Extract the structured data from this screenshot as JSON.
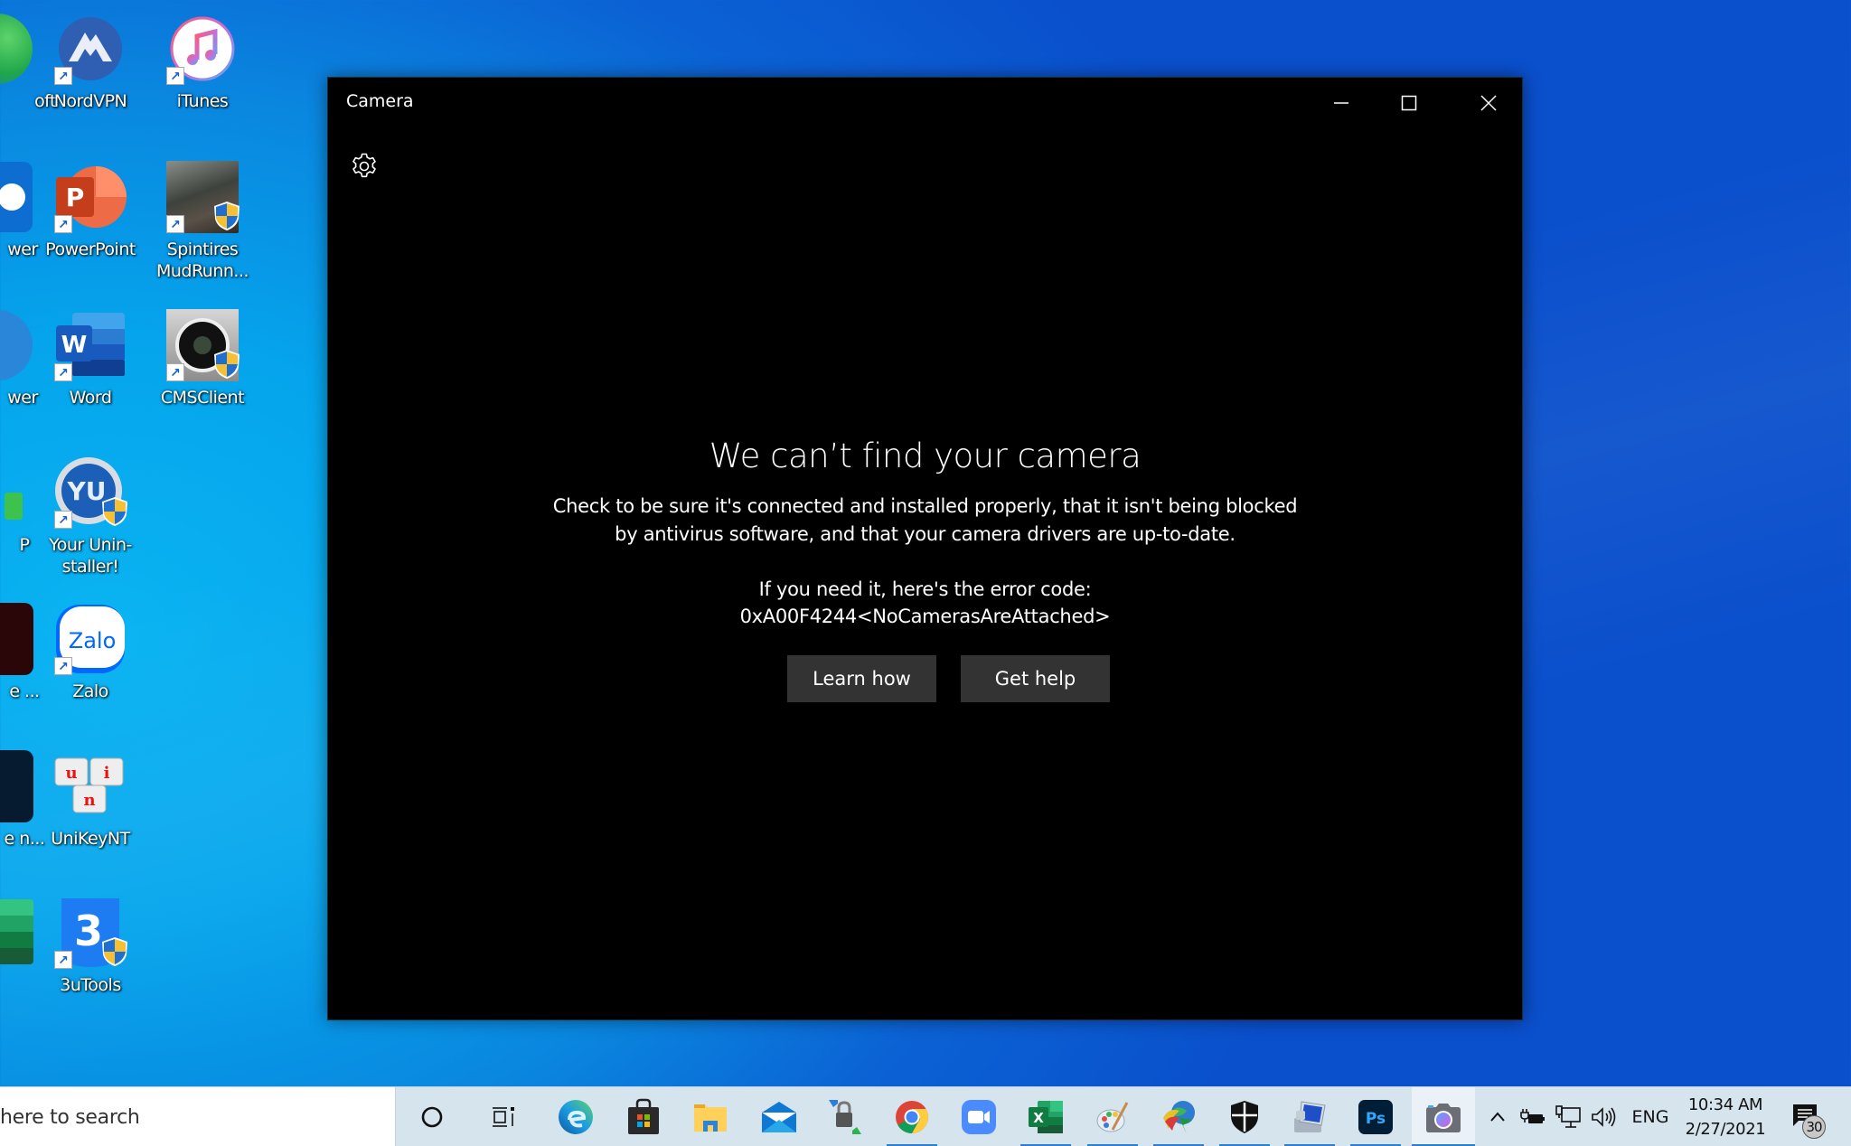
{
  "desktop": {
    "icons": [
      {
        "label": "oft",
        "icon": "edge-green-icon"
      },
      {
        "label": "NordVPN",
        "icon": "nordvpn-icon"
      },
      {
        "label": "iTunes",
        "icon": "itunes-icon"
      },
      {
        "label": "wer",
        "icon": "teamviewer-icon"
      },
      {
        "label": "PowerPoint",
        "icon": "powerpoint-icon"
      },
      {
        "label": "Spintires MudRunn...",
        "icon": "spintires-icon"
      },
      {
        "label": "wer",
        "icon": "blue-circle-icon"
      },
      {
        "label": "Word",
        "icon": "word-icon"
      },
      {
        "label": "CMSClient",
        "icon": "cmsclient-icon"
      },
      {
        "label": "P",
        "icon": "green-app-icon"
      },
      {
        "label": "Your Unin-staller!",
        "icon": "uninstaller-icon"
      },
      {
        "label": "e ...",
        "icon": "dark-red-app-icon"
      },
      {
        "label": "Zalo",
        "icon": "zalo-icon"
      },
      {
        "label": "e n...",
        "icon": "dark-blue-app-icon"
      },
      {
        "label": "UniKeyNT",
        "icon": "unikey-icon"
      },
      {
        "label": "",
        "icon": "excel-partial-icon"
      },
      {
        "label": "3uTools",
        "icon": "3utools-icon"
      }
    ]
  },
  "camera_window": {
    "title": "Camera",
    "controls": {
      "minimize": "minimize",
      "maximize": "maximize",
      "close": "close"
    },
    "settings_icon": "gear-icon",
    "error": {
      "title": "We can’t find your camera",
      "description_line1": "Check to be sure it's connected and installed properly, that it isn't being blocked",
      "description_line2": "by antivirus software, and that your camera drivers are up-to-date.",
      "code_intro": "If you need it, here's the error code:",
      "code": "0xA00F4244<NoCamerasAreAttached>"
    },
    "buttons": {
      "learn_how": "Learn how",
      "get_help": "Get help"
    }
  },
  "taskbar": {
    "search_placeholder": "here to search",
    "apps": [
      {
        "name": "cortana",
        "icon": "cortana-circle-icon",
        "running": false
      },
      {
        "name": "task-view",
        "icon": "task-view-icon",
        "running": false
      },
      {
        "name": "edge",
        "icon": "edge-icon",
        "running": false
      },
      {
        "name": "microsoft-store",
        "icon": "store-bag-icon",
        "running": false
      },
      {
        "name": "file-explorer",
        "icon": "folder-icon",
        "running": false
      },
      {
        "name": "mail",
        "icon": "mail-envelope-icon",
        "running": false
      },
      {
        "name": "vpn-lock-tool",
        "icon": "padlock-arrows-icon",
        "running": false
      },
      {
        "name": "chrome",
        "icon": "chrome-icon",
        "running": true
      },
      {
        "name": "zoom",
        "icon": "zoom-camera-icon",
        "running": false
      },
      {
        "name": "excel",
        "icon": "excel-icon",
        "running": true
      },
      {
        "name": "paint",
        "icon": "paint-palette-icon",
        "running": true
      },
      {
        "name": "internet-download-manager",
        "icon": "idm-globe-icon",
        "running": true
      },
      {
        "name": "windows-security",
        "icon": "shield-icon",
        "running": true
      },
      {
        "name": "network-tool",
        "icon": "computer-network-icon",
        "running": true
      },
      {
        "name": "photoshop",
        "icon": "photoshop-icon",
        "running": true
      },
      {
        "name": "camera",
        "icon": "camera-icon",
        "running": true,
        "active": true
      }
    ],
    "tray": {
      "show_hidden": "^",
      "language": "ENG",
      "time": "10:34 AM",
      "date": "2/27/2021",
      "notification_count": "30"
    }
  },
  "colors": {
    "taskbar_bg": "#d6e4ee",
    "window_bg": "#000000",
    "button_bg": "#333333",
    "running_indicator": "#2a7fd4"
  }
}
